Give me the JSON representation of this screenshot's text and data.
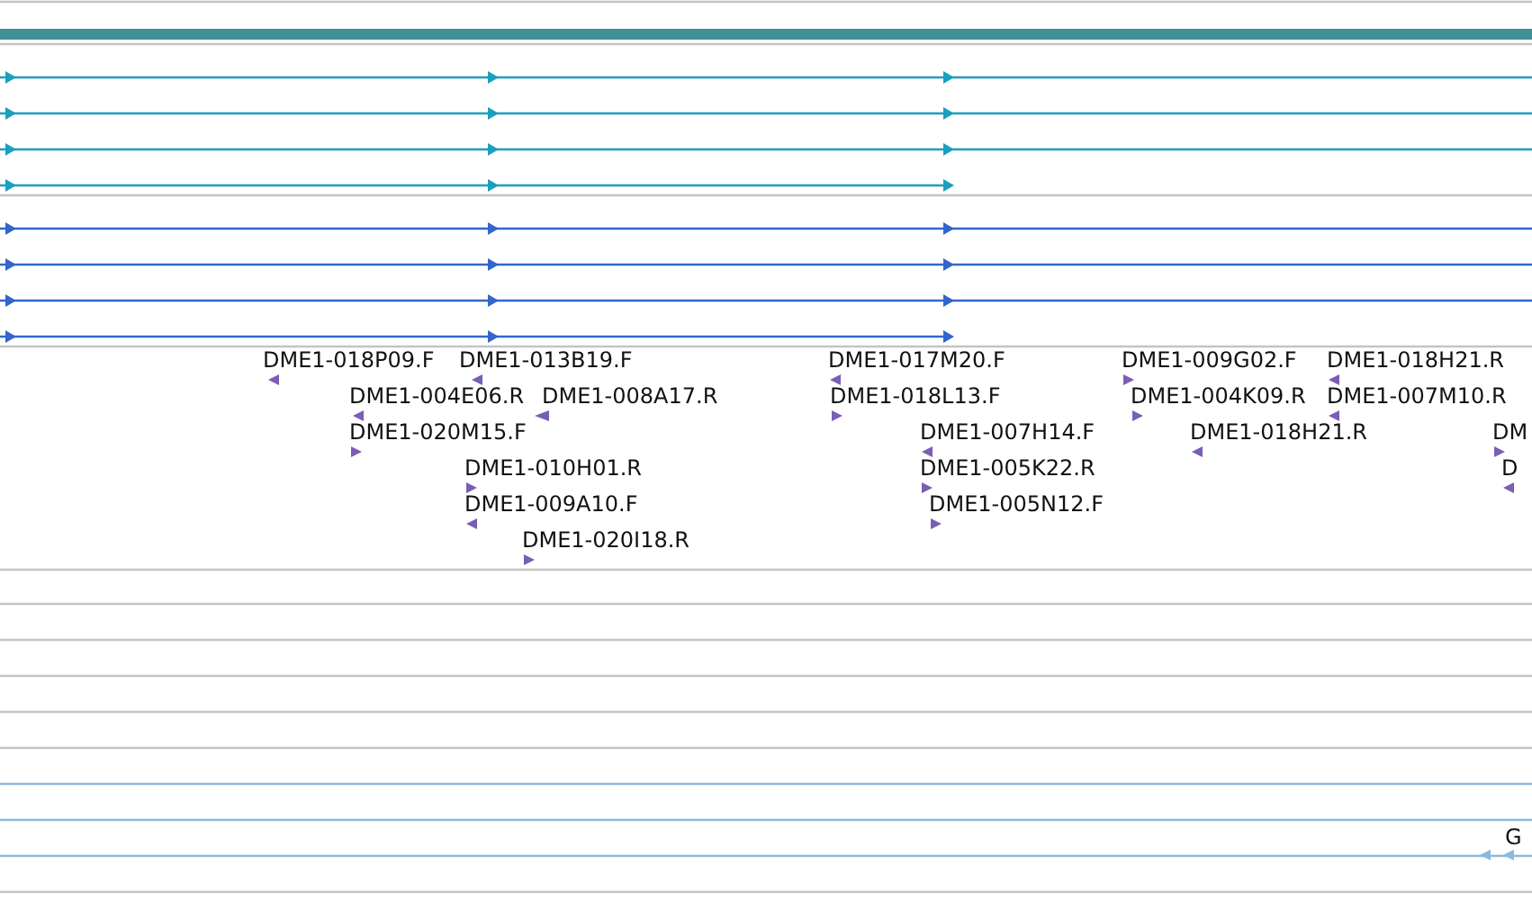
{
  "read_groups": [
    {
      "color": "#1a9fbf",
      "reads": [
        {
          "extends_right": true
        },
        {
          "extends_right": true
        },
        {
          "extends_right": true
        },
        {
          "extends_right": false
        }
      ]
    },
    {
      "color": "#3366cc",
      "reads": [
        {
          "extends_right": true
        },
        {
          "extends_right": true
        },
        {
          "extends_right": true
        },
        {
          "extends_right": false
        }
      ]
    }
  ],
  "features": [
    {
      "label": "DME1-018P09.F",
      "reverse": true
    },
    {
      "label": "DME1-013B19.F",
      "reverse": true
    },
    {
      "label": "DME1-004E06.R",
      "reverse": true
    },
    {
      "label": "DME1-008A17.R",
      "reverse": true
    },
    {
      "label": "DME1-020M15.F",
      "reverse": false
    },
    {
      "label": "DME1-010H01.R",
      "reverse": false
    },
    {
      "label": "DME1-009A10.F",
      "reverse": true
    },
    {
      "label": "DME1-020I18.R",
      "reverse": false
    },
    {
      "label": "DME1-017M20.F",
      "reverse": true
    },
    {
      "label": "DME1-018L13.F",
      "reverse": false
    },
    {
      "label": "DME1-007H14.F",
      "reverse": true
    },
    {
      "label": "DME1-005K22.R",
      "reverse": false
    },
    {
      "label": "DME1-005N12.F",
      "reverse": false
    },
    {
      "label": "DME1-009G02.F",
      "reverse": false
    },
    {
      "label": "DME1-004K09.R",
      "reverse": false
    },
    {
      "label": "DME1-018H21.R",
      "reverse": true
    },
    {
      "label": "DME1-018H21.R",
      "reverse": true
    },
    {
      "label": "DME1-007M10.R",
      "reverse": true
    },
    {
      "label": "DM",
      "reverse": false
    },
    {
      "label": "D",
      "reverse": true
    }
  ],
  "bottom_feature": {
    "label": "G",
    "reverse": true,
    "color": "#8ab8e0"
  }
}
